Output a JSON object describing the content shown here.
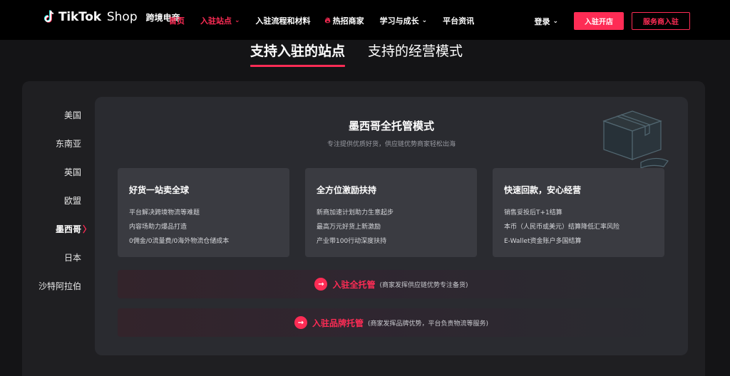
{
  "header": {
    "brand": "TikTok",
    "brand_suffix": "Shop",
    "brand_sub": "跨境电商",
    "nav": [
      {
        "label": "首页",
        "active": true
      },
      {
        "label": "入驻站点",
        "active": true,
        "dropdown": true
      },
      {
        "label": "入驻流程和材料"
      },
      {
        "label": "热招商家",
        "icon": "flame-icon"
      },
      {
        "label": "学习与成长",
        "dropdown": true
      },
      {
        "label": "平台资讯"
      }
    ],
    "login": "登录",
    "cta_primary": "入驻开店",
    "cta_secondary": "服务商入驻"
  },
  "tabs": [
    "支持入驻的站点",
    "支持的经营模式"
  ],
  "sites": [
    "美国",
    "东南亚",
    "英国",
    "欧盟",
    "墨西哥",
    "日本",
    "沙特阿拉伯"
  ],
  "active_site": "墨西哥",
  "panel": {
    "title": "墨西哥全托管模式",
    "subtitle": "专注提供优质好货，供应链优势商家轻松出海",
    "cards": [
      {
        "title": "好货一站卖全球",
        "lines": [
          "平台解决跨境物流等难题",
          "内容场助力爆品打造",
          "0佣金/0流量费/0海外物流仓储成本"
        ]
      },
      {
        "title": "全方位激励扶持",
        "lines": [
          "新商加速计划助力生意起步",
          "最高万元好货上新激励",
          "产业带100行动深度扶持"
        ]
      },
      {
        "title": "快速回款，安心经营",
        "lines": [
          "销售妥投后T+1结算",
          "本币（人民币或美元）结算降低汇率风险",
          "E-Wallet资金账户多国结算"
        ]
      }
    ],
    "ctas": [
      {
        "label": "入驻全托管",
        "note": "(商家发挥供应链优势专注备货)"
      },
      {
        "label": "入驻品牌托管",
        "note": "(商家发挥品牌优势，平台负责物流等服务)"
      }
    ]
  },
  "colors": {
    "accent": "#fe2c55",
    "page_bg": "#141416",
    "panel_bg": "#2a2b30",
    "card_bg": "#3a3b41"
  }
}
